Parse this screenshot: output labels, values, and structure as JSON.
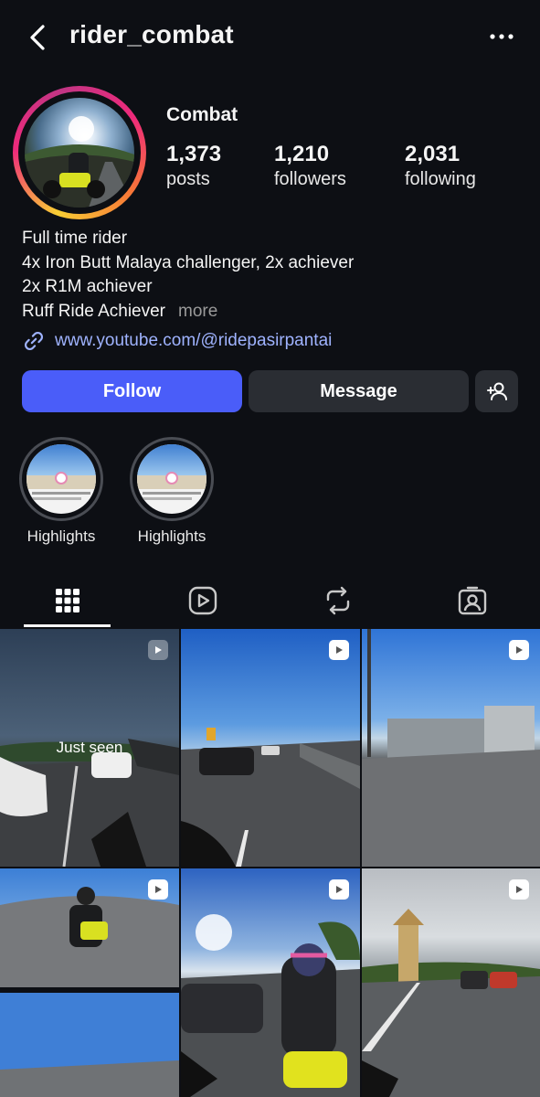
{
  "header": {
    "username": "rider_combat"
  },
  "profile": {
    "display_name": "Combat",
    "stats": [
      {
        "value": "1,373",
        "label": "posts"
      },
      {
        "value": "1,210",
        "label": "followers"
      },
      {
        "value": "2,031",
        "label": "following"
      }
    ],
    "bio": [
      "Full time rider",
      "4x Iron Butt Malaya challenger, 2x achiever",
      "2x R1M achiever",
      "Ruff Ride Achiever"
    ],
    "bio_more": "more",
    "link": "www.youtube.com/@ridepasirpantai"
  },
  "actions": {
    "follow": "Follow",
    "message": "Message"
  },
  "highlights": [
    {
      "label": "Highlights"
    },
    {
      "label": "Highlights"
    }
  ],
  "tabs": [
    {
      "icon": "grid-icon",
      "active": true
    },
    {
      "icon": "reels-icon",
      "active": false
    },
    {
      "icon": "repost-icon",
      "active": false
    },
    {
      "icon": "tagged-icon",
      "active": false
    }
  ],
  "posts": [
    {
      "type": "reel",
      "overlay": "Just seen"
    },
    {
      "type": "reel",
      "overlay": ""
    },
    {
      "type": "reel",
      "overlay": ""
    },
    {
      "type": "reel",
      "overlay": ""
    },
    {
      "type": "reel",
      "overlay": ""
    },
    {
      "type": "reel",
      "overlay": ""
    }
  ],
  "colors": {
    "background": "#0d0f14",
    "follow_button": "#4a5df9",
    "link": "#9fb3ff",
    "secondary_button": "#2a2d33"
  }
}
